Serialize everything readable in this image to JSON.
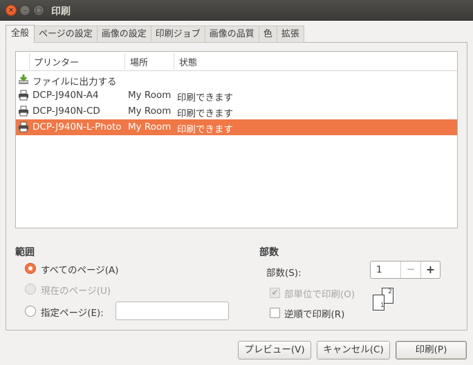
{
  "window": {
    "title": "印刷"
  },
  "tabs": [
    "全般",
    "ページの設定",
    "画像の設定",
    "印刷ジョブ",
    "画像の品質",
    "色",
    "拡張"
  ],
  "printer_list": {
    "columns": [
      "プリンター",
      "場所",
      "状態"
    ],
    "rows": [
      {
        "name": "ファイルに出力する",
        "location": "",
        "status": "",
        "icon": "print-to-file-icon"
      },
      {
        "name": "DCP-J940N-A4",
        "location": "My Room",
        "status": "印刷できます",
        "icon": "printer-icon"
      },
      {
        "name": "DCP-J940N-CD",
        "location": "My Room",
        "status": "印刷できます",
        "icon": "printer-icon"
      },
      {
        "name": "DCP-J940N-L-Photo",
        "location": "My Room",
        "status": "印刷できます",
        "icon": "printer-icon",
        "selected": true
      }
    ]
  },
  "range": {
    "heading": "範囲",
    "all_pages": "すべてのページ(A)",
    "current_page": "現在のページ(U)",
    "specified_pages": "指定ページ(E):",
    "pages_value": "",
    "selected": "all_pages"
  },
  "copies": {
    "heading": "部数",
    "label": "部数(S):",
    "value": "1",
    "minus": "−",
    "plus": "+",
    "collate": "部単位で印刷(O)",
    "collate_checked": true,
    "reverse": "逆順で印刷(R)",
    "reverse_checked": false,
    "collate_icon": {
      "page1": "1",
      "page2": "2"
    }
  },
  "buttons": {
    "preview": "プレビュー(V)",
    "cancel": "キャンセル(C)",
    "print": "印刷(P)"
  },
  "colors": {
    "accent": "#f07746",
    "titlebar": "#3c3b37",
    "close": "#df4a16"
  }
}
